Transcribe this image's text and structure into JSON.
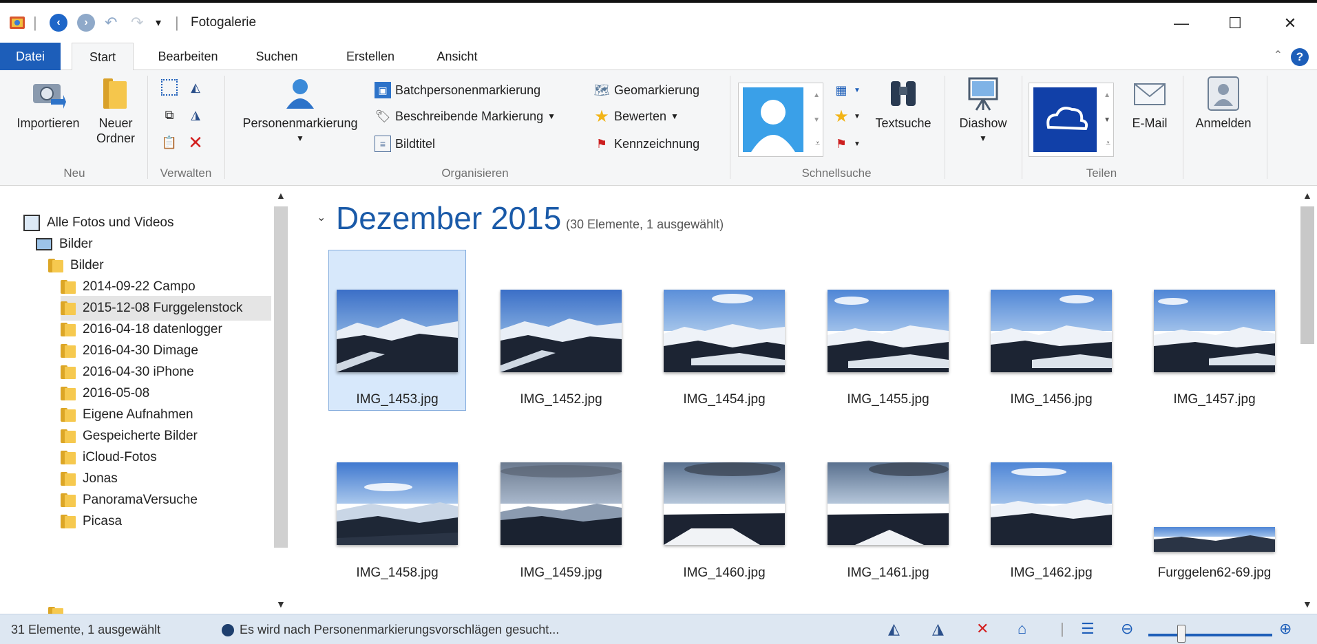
{
  "window": {
    "title": "Fotogalerie",
    "minimize_glyph": "—",
    "maximize_glyph": "☐",
    "close_glyph": "✕"
  },
  "tabs": [
    {
      "label": "Datei"
    },
    {
      "label": "Start"
    },
    {
      "label": "Bearbeiten"
    },
    {
      "label": "Suchen"
    },
    {
      "label": "Erstellen"
    },
    {
      "label": "Ansicht"
    }
  ],
  "ribbon": {
    "neu": {
      "group_label": "Neu",
      "importieren": "Importieren",
      "neuer_ordner_line1": "Neuer",
      "neuer_ordner_line2": "Ordner"
    },
    "verwalten": {
      "group_label": "Verwalten"
    },
    "organisieren": {
      "group_label": "Organisieren",
      "personenmarkierung": "Personenmarkierung",
      "batchpersonenmarkierung": "Batchpersonenmarkierung",
      "beschreibende_markierung": "Beschreibende Markierung",
      "bildtitel": "Bildtitel",
      "geomarkierung": "Geomarkierung",
      "bewerten": "Bewerten",
      "kennzeichnung": "Kennzeichnung"
    },
    "schnellsuche": {
      "group_label": "Schnellsuche",
      "textsuche": "Textsuche"
    },
    "diashow": {
      "label": "Diashow"
    },
    "teilen": {
      "group_label": "Teilen",
      "email": "E-Mail"
    },
    "anmelden": {
      "label": "Anmelden"
    }
  },
  "nav": {
    "items": [
      {
        "label": "Alle Fotos und Videos"
      },
      {
        "label": "Bilder"
      },
      {
        "label": "Bilder"
      },
      {
        "label": "2014-09-22 Campo"
      },
      {
        "label": "2015-12-08 Furggelenstock"
      },
      {
        "label": "2016-04-18 datenlogger"
      },
      {
        "label": "2016-04-30 Dimage"
      },
      {
        "label": "2016-04-30 iPhone"
      },
      {
        "label": "2016-05-08"
      },
      {
        "label": "Eigene Aufnahmen"
      },
      {
        "label": "Gespeicherte Bilder"
      },
      {
        "label": "iCloud-Fotos"
      },
      {
        "label": "Jonas"
      },
      {
        "label": "PanoramaVersuche"
      },
      {
        "label": "Picasa"
      }
    ]
  },
  "gallery": {
    "heading": "Dezember 2015",
    "count": "(30 Elemente, 1 ausgewählt)",
    "photos": [
      {
        "name": "IMG_1453.jpg"
      },
      {
        "name": "IMG_1452.jpg"
      },
      {
        "name": "IMG_1454.jpg"
      },
      {
        "name": "IMG_1455.jpg"
      },
      {
        "name": "IMG_1456.jpg"
      },
      {
        "name": "IMG_1457.jpg"
      },
      {
        "name": "IMG_1458.jpg"
      },
      {
        "name": "IMG_1459.jpg"
      },
      {
        "name": "IMG_1460.jpg"
      },
      {
        "name": "IMG_1461.jpg"
      },
      {
        "name": "IMG_1462.jpg"
      },
      {
        "name": "Furggelen62-69.jpg"
      }
    ]
  },
  "status": {
    "selection": "31 Elemente, 1 ausgewählt",
    "message": "Es wird nach Personenmarkierungsvorschlägen gesucht..."
  },
  "colors": {
    "accent": "#1d5eb9",
    "selection_bg": "#d7e8fb",
    "status_bg": "#dde7f2"
  }
}
